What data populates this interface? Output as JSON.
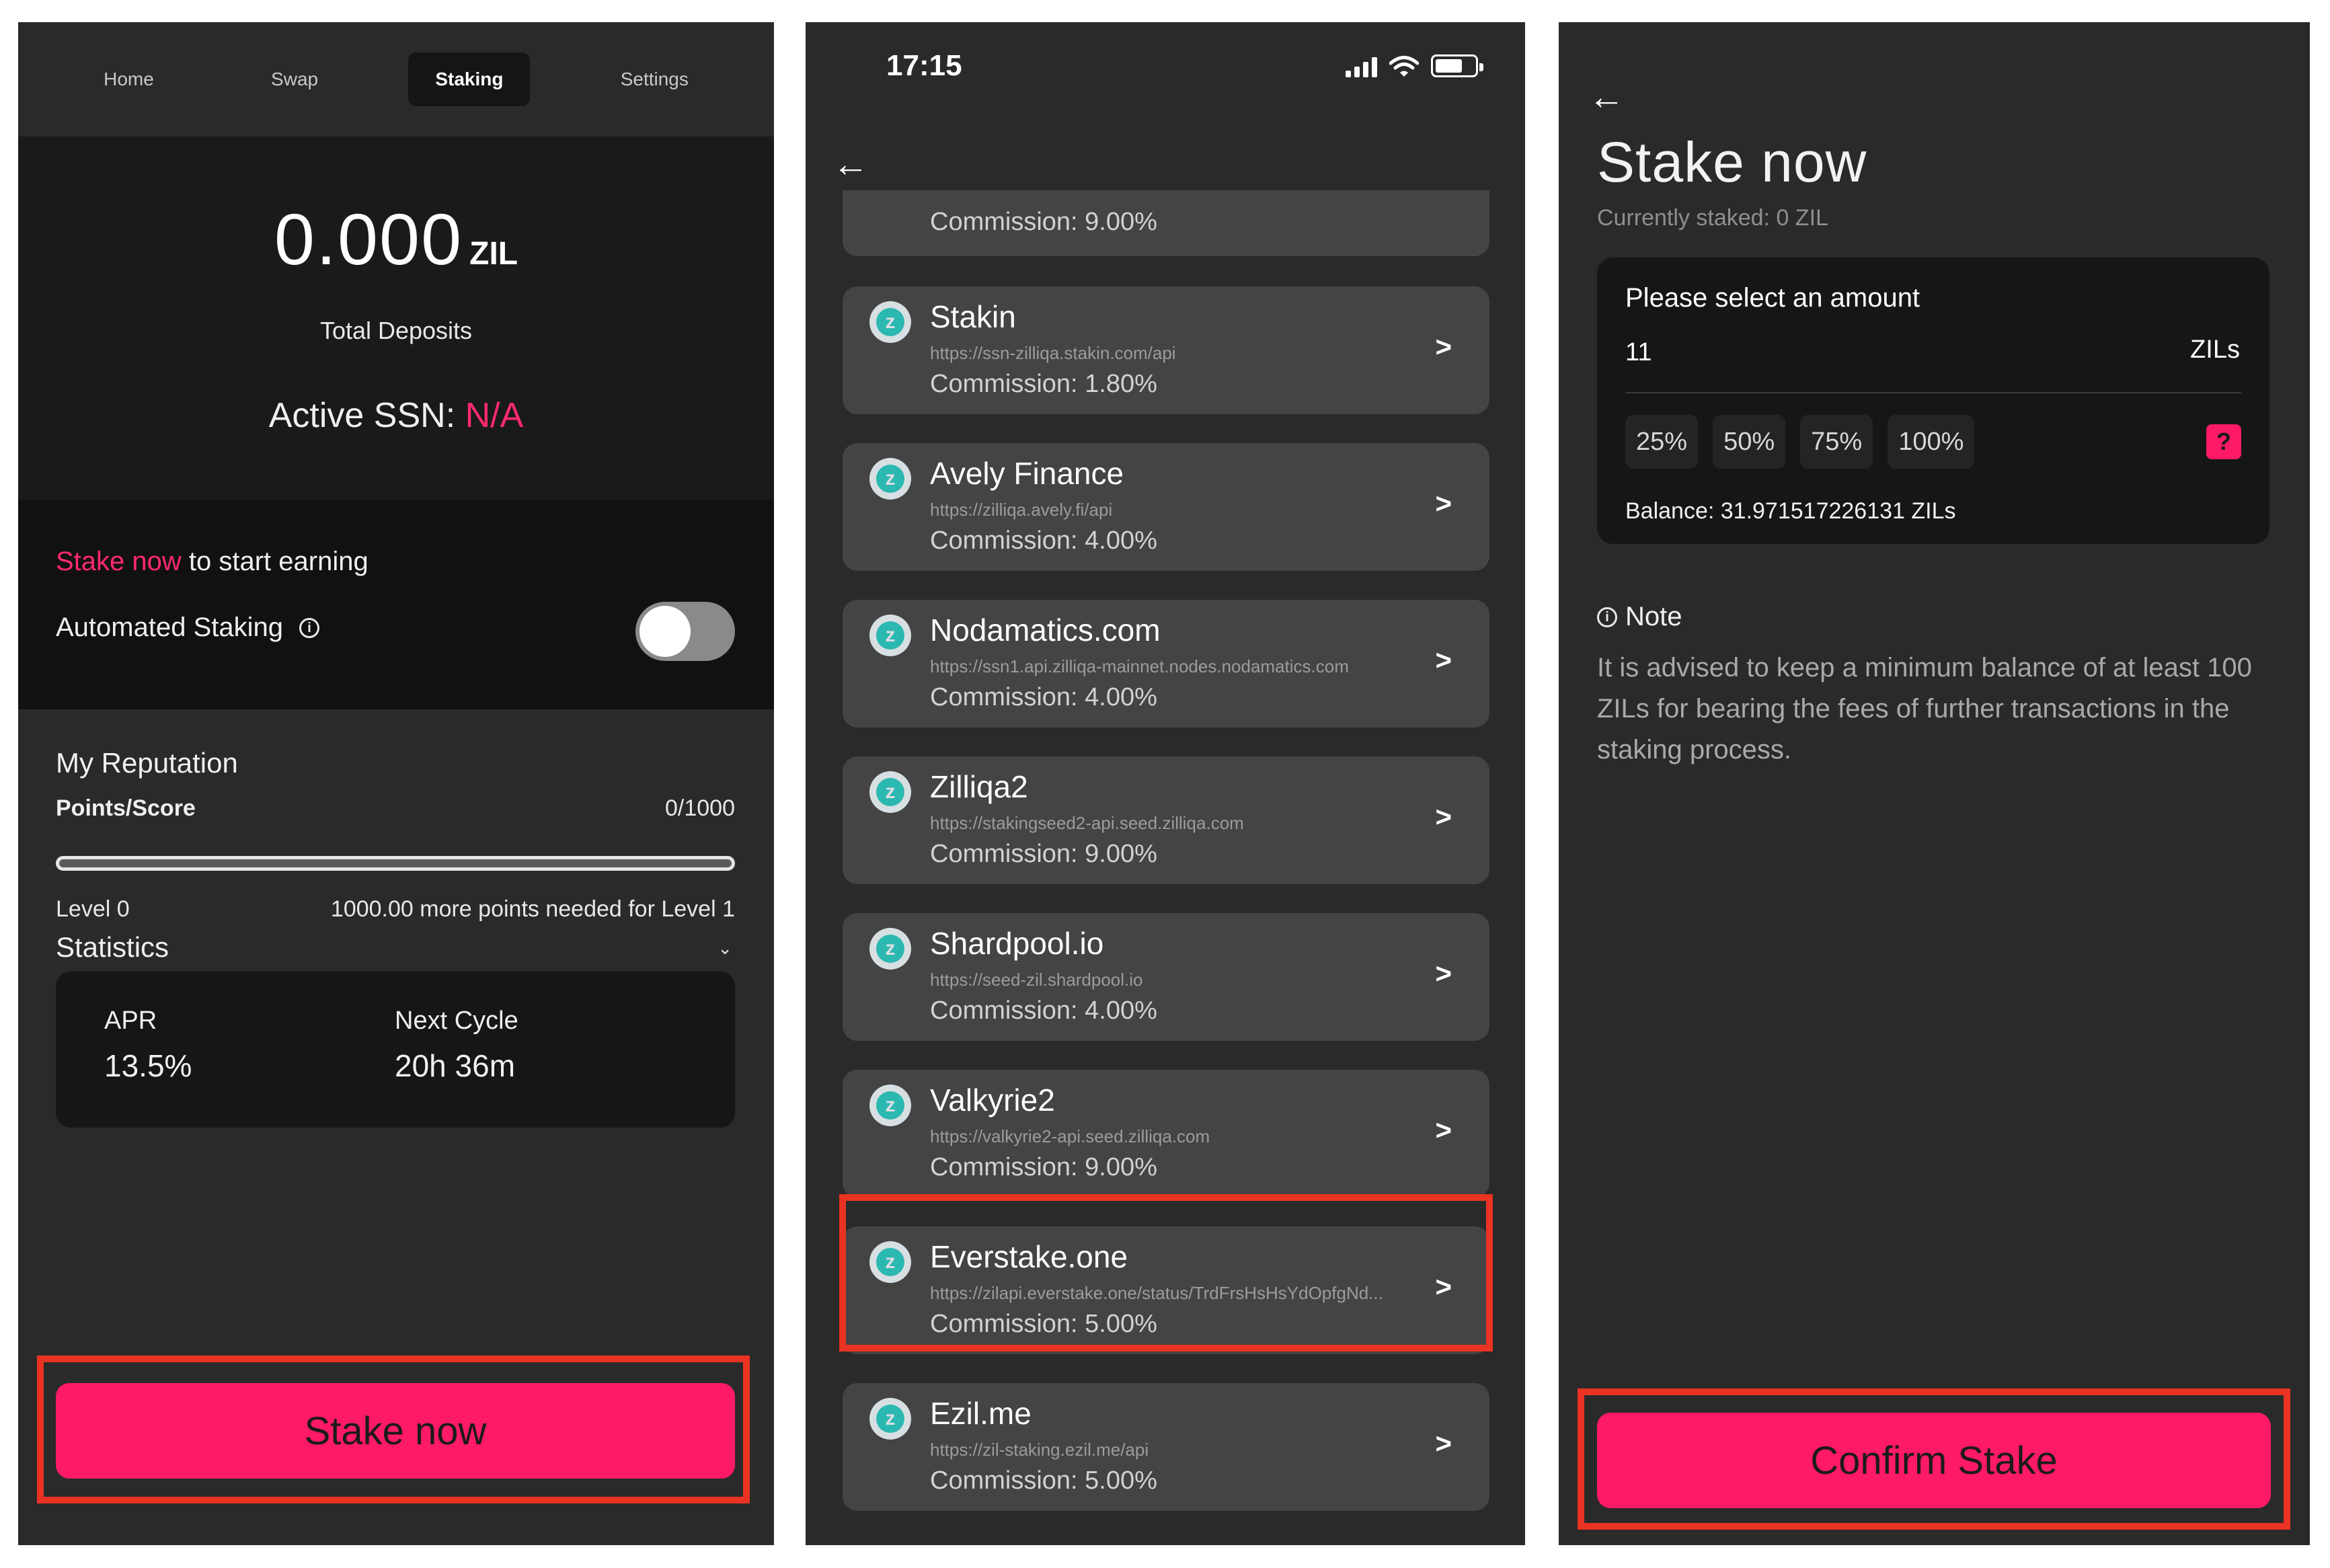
{
  "panel1": {
    "nav_tabs": [
      {
        "label": "Home",
        "active": false
      },
      {
        "label": "Swap",
        "active": false
      },
      {
        "label": "Staking",
        "active": true
      },
      {
        "label": "Settings",
        "active": false
      }
    ],
    "total_deposits": {
      "amount": "0.000",
      "unit": "ZIL",
      "label": "Total Deposits"
    },
    "active_ssn": {
      "label": "Active SSN:",
      "value": "N/A"
    },
    "stake_prompt": {
      "link": "Stake now",
      "text": "to start earning"
    },
    "automated_staking": {
      "label": "Automated Staking",
      "info_icon": "info-icon",
      "enabled": false
    },
    "reputation": {
      "title": "My Reputation",
      "points_label": "Points/Score",
      "points_value": "0/1000",
      "progress_fraction": 0,
      "level_label": "Level 0",
      "level_need": "1000.00 more points needed for Level 1"
    },
    "statistics": {
      "title": "Statistics",
      "chevron_icon": "chevron-down-icon",
      "apr_label": "APR",
      "apr_value": "13.5%",
      "cycle_label": "Next Cycle",
      "cycle_value": "20h 36m"
    },
    "stake_button": "Stake now"
  },
  "panel2": {
    "status_time": "17:15",
    "back_icon": "back-arrow-icon",
    "partial_commission": "Commission: 9.00%",
    "validators": [
      {
        "name": "Stakin",
        "url": "https://ssn-zilliqa.stakin.com/api",
        "commission": "Commission: 1.80%"
      },
      {
        "name": "Avely Finance",
        "url": "https://zilliqa.avely.fi/api",
        "commission": "Commission: 4.00%"
      },
      {
        "name": "Nodamatics.com",
        "url": "https://ssn1.api.zilliqa-mainnet.nodes.nodamatics.com",
        "commission": "Commission: 4.00%"
      },
      {
        "name": "Zilliqa2",
        "url": "https://stakingseed2-api.seed.zilliqa.com",
        "commission": "Commission: 9.00%"
      },
      {
        "name": "Shardpool.io",
        "url": "https://seed-zil.shardpool.io",
        "commission": "Commission: 4.00%"
      },
      {
        "name": "Valkyrie2",
        "url": "https://valkyrie2-api.seed.zilliqa.com",
        "commission": "Commission: 9.00%"
      },
      {
        "name": "Everstake.one",
        "url": "https://zilapi.everstake.one/status/TrdFrsHsHsYdOpfgNd...",
        "commission": "Commission: 5.00%"
      },
      {
        "name": "Ezil.me",
        "url": "https://zil-staking.ezil.me/api",
        "commission": "Commission: 5.00%"
      }
    ]
  },
  "panel3": {
    "back_icon": "back-arrow-icon",
    "title": "Stake now",
    "currently_staked": "Currently staked: 0 ZIL",
    "amount_prompt": "Please select an amount",
    "amount_value": "11",
    "amount_unit": "ZILs",
    "percent_options": [
      "25%",
      "50%",
      "75%",
      "100%"
    ],
    "help_label": "?",
    "balance": "Balance: 31.971517226131 ZILs",
    "note_title": "Note",
    "note_text": "It is advised to keep a minimum balance of at least 100 ZILs for bearing the fees of further transactions in the staking process.",
    "confirm_button": "Confirm Stake"
  },
  "colors": {
    "accent": "#ff1a66",
    "highlight_frame": "#ea3323",
    "card": "#444444",
    "panel": "#2a2a2a"
  }
}
